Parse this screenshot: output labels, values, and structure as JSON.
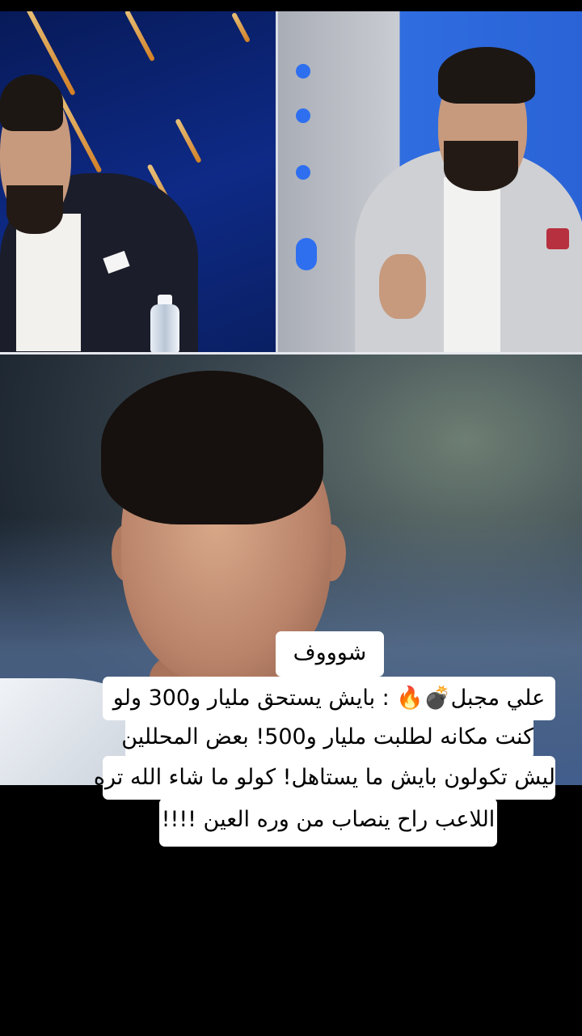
{
  "caption": {
    "title": "شوووف",
    "lines": [
      "علي مجبل💣🔥 : بايش يستحق مليار و300 ولو",
      "كنت مكانه لطلبت مليار و500! بعض المحللين",
      "ليش تكولون بايش ما يستاهل! كولو ما شاء الله تره",
      "اللاعب راح ينصاب من وره العين !!!!"
    ]
  },
  "colors": {
    "background": "#000000",
    "caption_bg": "#ffffff",
    "caption_text": "#000000",
    "studio_blue": "#0e2a86"
  }
}
